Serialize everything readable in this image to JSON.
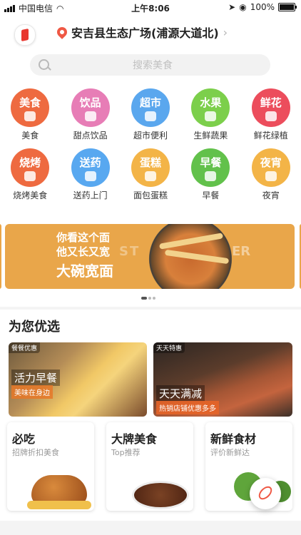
{
  "status_bar": {
    "carrier": "中国电信",
    "time": "上午8:06",
    "battery": "100%"
  },
  "header": {
    "location": "安吉县生态广场(浦源大道北)",
    "search_placeholder": "搜索美食"
  },
  "categories": [
    {
      "icon_text": "美食",
      "label": "美食",
      "color": "#ee6a40"
    },
    {
      "icon_text": "饮品",
      "label": "甜点饮品",
      "color": "#e77db6"
    },
    {
      "icon_text": "超市",
      "label": "超市便利",
      "color": "#5aa7ee"
    },
    {
      "icon_text": "水果",
      "label": "生鲜蔬果",
      "color": "#7ccf4b"
    },
    {
      "icon_text": "鲜花",
      "label": "鲜花绿植",
      "color": "#ec4d5c"
    },
    {
      "icon_text": "烧烤",
      "label": "烧烤美食",
      "color": "#ee6a40"
    },
    {
      "icon_text": "送药",
      "label": "送药上门",
      "color": "#58a8f0"
    },
    {
      "icon_text": "蛋糕",
      "label": "面包蛋糕",
      "color": "#f3b447"
    },
    {
      "icon_text": "早餐",
      "label": "早餐",
      "color": "#62c14b"
    },
    {
      "icon_text": "夜宵",
      "label": "夜宵",
      "color": "#f3b447"
    }
  ],
  "banner": {
    "line1": "你看这个面",
    "line2": "他又长又宽",
    "line3": "大碗宽面",
    "watermark_left": "ST",
    "watermark_right": "ER"
  },
  "recommend": {
    "title": "为您优选",
    "cards": [
      {
        "tag": "餐餐优惠",
        "title": "活力早餐",
        "subtitle": "美味在身边"
      },
      {
        "tag": "天天特惠",
        "title": "天天满减",
        "subtitle": "热销店铺优惠多多"
      }
    ],
    "tiles": [
      {
        "title": "必吃",
        "subtitle": "招牌折扣美食",
        "icon": "roast-chicken-icon"
      },
      {
        "title": "大牌美食",
        "subtitle": "Top推荐",
        "icon": "steak-icon"
      },
      {
        "title": "新鲜食材",
        "subtitle": "评价新鲜达",
        "icon": "broccoli-icon"
      }
    ]
  }
}
